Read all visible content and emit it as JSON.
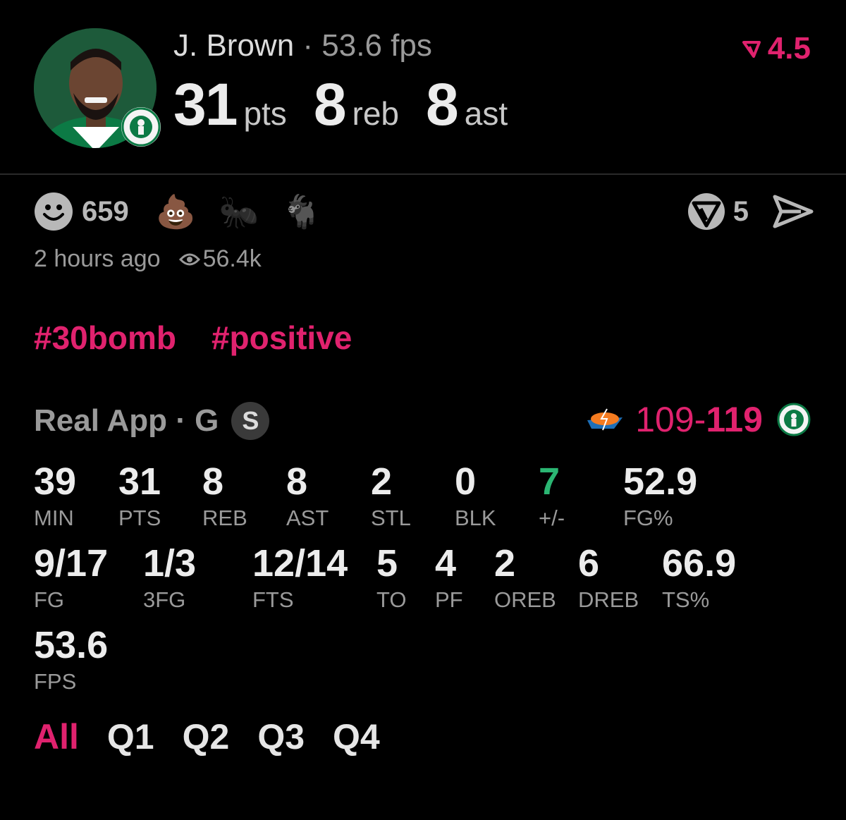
{
  "player": {
    "name": "J. Brown",
    "separator": "·",
    "fps": "53.6 fps",
    "headline": [
      {
        "value": "31",
        "unit": "pts"
      },
      {
        "value": "8",
        "unit": "reb"
      },
      {
        "value": "8",
        "unit": "ast"
      }
    ]
  },
  "rating": {
    "value": "4.5",
    "icon": "rating-arrow-icon"
  },
  "reactions": {
    "smile_icon": "smile-icon",
    "count": "659",
    "emojis": [
      "💩",
      "🐜",
      "🐐"
    ],
    "boost_count": "5"
  },
  "meta": {
    "time": "2 hours ago",
    "views": "56.4k"
  },
  "tags": [
    "#30bomb",
    "#positive"
  ],
  "game": {
    "source": "Real App · G",
    "badge": "S",
    "score_away": "109",
    "score_dash": "-",
    "score_home": "119"
  },
  "stats_row1": [
    {
      "value": "39",
      "label": "MIN"
    },
    {
      "value": "31",
      "label": "PTS"
    },
    {
      "value": "8",
      "label": "REB"
    },
    {
      "value": "8",
      "label": "AST"
    },
    {
      "value": "2",
      "label": "STL"
    },
    {
      "value": "0",
      "label": "BLK"
    },
    {
      "value": "7",
      "label": "+/-"
    },
    {
      "value": "52.9",
      "label": "FG%"
    }
  ],
  "stats_row2": [
    {
      "value": "9/17",
      "label": "FG"
    },
    {
      "value": "1/3",
      "label": "3FG"
    },
    {
      "value": "12/14",
      "label": "FTS"
    },
    {
      "value": "5",
      "label": "TO"
    },
    {
      "value": "4",
      "label": "PF"
    },
    {
      "value": "2",
      "label": "OREB"
    },
    {
      "value": "6",
      "label": "DREB"
    },
    {
      "value": "66.9",
      "label": "TS%"
    }
  ],
  "stats_row3": [
    {
      "value": "53.6",
      "label": "FPS"
    }
  ],
  "quarters": [
    "All",
    "Q1",
    "Q2",
    "Q3",
    "Q4"
  ],
  "colors": {
    "accent": "#e0226e",
    "positive": "#2bb673",
    "background": "#000000"
  }
}
